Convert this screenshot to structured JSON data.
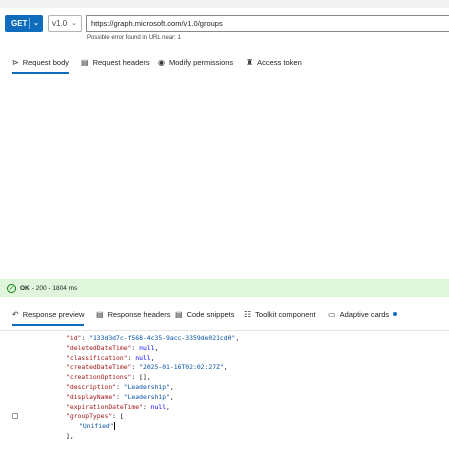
{
  "request": {
    "method": "GET",
    "version": "v1.0",
    "url": "https://graph.microsoft.com/v1.0/groups",
    "url_hint": "Possible error found in URL near: 1"
  },
  "request_tabs": [
    {
      "label": "Request body",
      "icon": "send-icon"
    },
    {
      "label": "Request headers",
      "icon": "document-icon"
    },
    {
      "label": "Modify permissions",
      "icon": "permissions-icon"
    },
    {
      "label": "Access token",
      "icon": "key-icon"
    }
  ],
  "status": {
    "ok": "OK",
    "detail": " - 200 - 1804 ms",
    "color": "#dff6dd"
  },
  "response_tabs": [
    {
      "label": "Response preview",
      "icon": "preview-icon"
    },
    {
      "label": "Response headers",
      "icon": "document-icon"
    },
    {
      "label": "Code snippets",
      "icon": "code-icon"
    },
    {
      "label": "Toolkit component",
      "icon": "toolkit-icon"
    },
    {
      "label": "Adaptive cards",
      "icon": "card-icon"
    }
  ],
  "json_lines": [
    {
      "key": "\"id\"",
      "value": "\"133d3d7c-f568-4c35-9acc-3359de021cd0\"",
      "vtype": "s",
      "tail": ","
    },
    {
      "key": "\"deletedDateTime\"",
      "value": "null",
      "vtype": "n",
      "tail": ","
    },
    {
      "key": "\"classification\"",
      "value": "null",
      "vtype": "n",
      "tail": ","
    },
    {
      "key": "\"createdDateTime\"",
      "value": "\"2025-01-16T02:02:27Z\"",
      "vtype": "s",
      "tail": ","
    },
    {
      "key": "\"creationOptions\"",
      "value": "[]",
      "vtype": "p",
      "tail": ","
    },
    {
      "key": "\"description\"",
      "value": "\"Leadership\"",
      "vtype": "s",
      "tail": ","
    },
    {
      "key": "\"displayName\"",
      "value": "\"Leadership\"",
      "vtype": "s",
      "tail": ","
    },
    {
      "key": "\"expirationDateTime\"",
      "value": "null",
      "vtype": "n",
      "tail": ","
    },
    {
      "key": "\"groupTypes\"",
      "value": "[",
      "vtype": "p",
      "tail": ""
    },
    {
      "key": "",
      "value": "\"Unified\"",
      "vtype": "s",
      "tail": ""
    },
    {
      "key": "",
      "value": "],",
      "vtype": "p",
      "tail": ""
    }
  ],
  "colors": {
    "accent": "#0f6cbd",
    "json_key": "#a31515",
    "json_string": "#0451a5",
    "json_keyword": "#0000ff"
  }
}
